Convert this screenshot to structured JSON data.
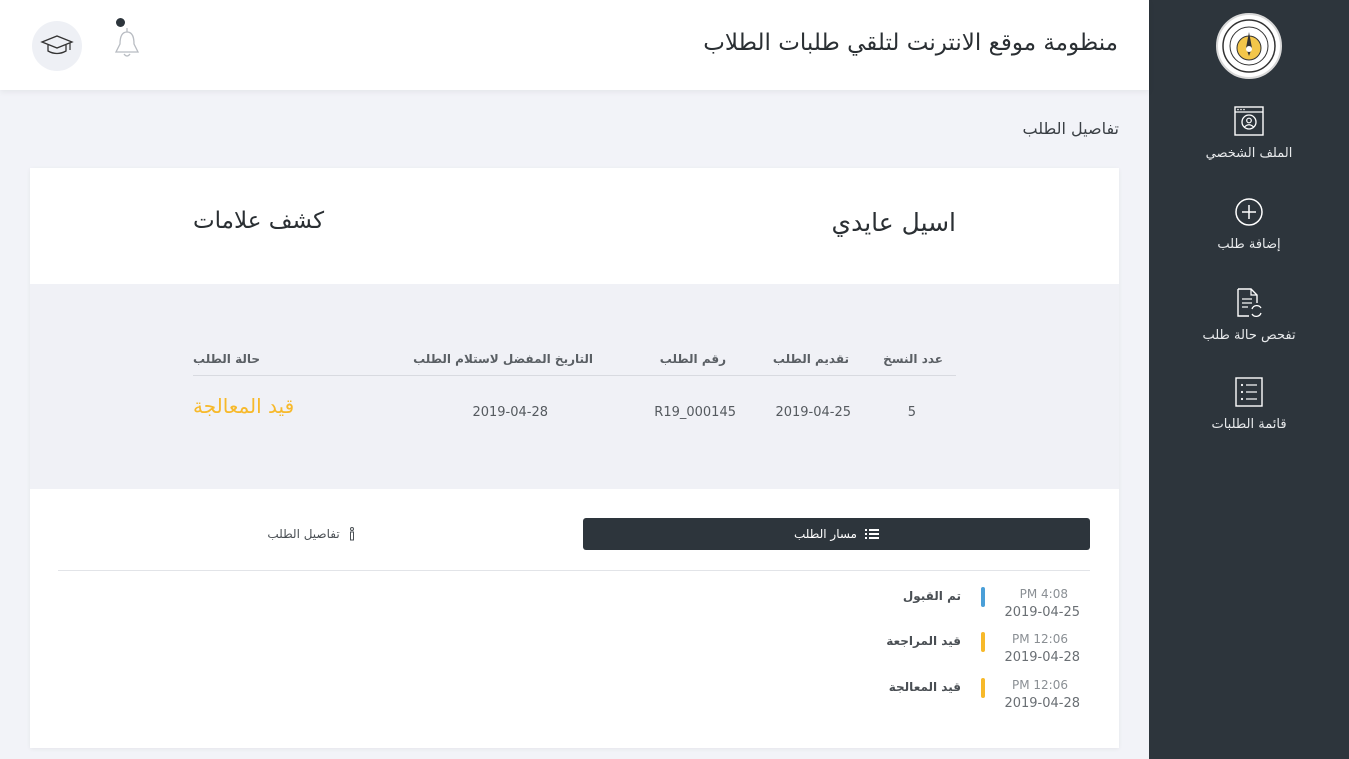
{
  "header": {
    "title": "منظومة موقع الانترنت لتلقي طلبات الطلاب"
  },
  "sidebar": {
    "items": [
      {
        "label": "الملف الشخصي",
        "icon": "profile-icon"
      },
      {
        "label": "إضافة طلب",
        "icon": "add-circle-icon"
      },
      {
        "label": "تفحص حالة طلب",
        "icon": "document-refresh-icon"
      },
      {
        "label": "قائمة الطلبات",
        "icon": "list-icon"
      }
    ]
  },
  "page": {
    "heading": "تفاصيل الطلب"
  },
  "request": {
    "student_name": "اسيل عايدي",
    "type": "كشف علامات",
    "columns": {
      "copies": "عدد النسخ",
      "submitted": "تقديم الطلب",
      "number": "رقم الطلب",
      "preferred_date": "التاريخ المفضل لاستلام الطلب",
      "status": "حالة الطلب"
    },
    "values": {
      "copies": "5",
      "submitted": "2019-04-25",
      "number": "R19_000145",
      "preferred_date": "2019-04-28",
      "status": "قيد المعالجة"
    },
    "status_color": "#f7b92a"
  },
  "tabs": {
    "track": "مسار الطلب",
    "details": "تفاصيل الطلب"
  },
  "timeline": [
    {
      "time": "PM 4:08",
      "date": "2019-04-25",
      "status": "تم القبول",
      "color": "#4a9fd8"
    },
    {
      "time": "PM 12:06",
      "date": "2019-04-28",
      "status": "قيد المراجعة",
      "color": "#f7b92a"
    },
    {
      "time": "PM 12:06",
      "date": "2019-04-28",
      "status": "قيد المعالجة",
      "color": "#f7b92a"
    }
  ],
  "colors": {
    "sidebar": "#2d353c",
    "accent": "#f7b92a",
    "background": "#f2f3f8"
  }
}
